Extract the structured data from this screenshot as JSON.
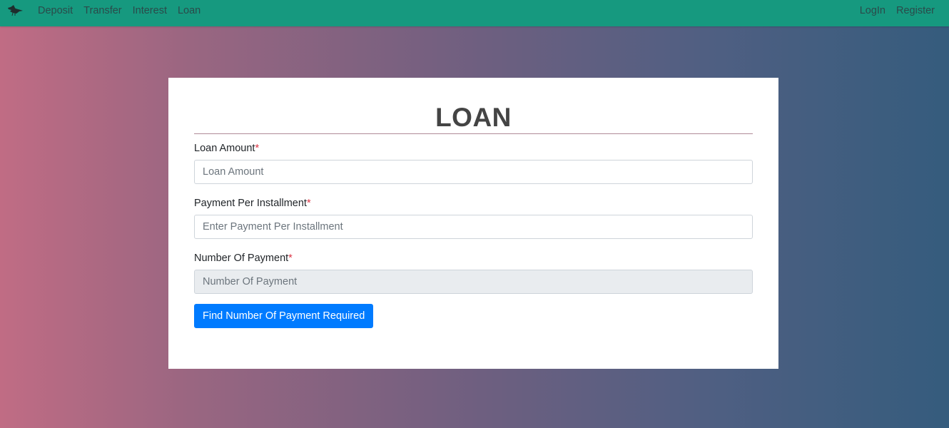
{
  "nav": {
    "brand_icon": "bird-logo-icon",
    "left_links": [
      "Deposit",
      "Transfer",
      "Interest",
      "Loan"
    ],
    "right_links": [
      "LogIn",
      "Register"
    ]
  },
  "form": {
    "title": "LOAN",
    "required_marker": "*",
    "loan_amount": {
      "label": "Loan Amount",
      "placeholder": "Loan Amount",
      "value": ""
    },
    "payment_per_installment": {
      "label": "Payment Per Installment",
      "placeholder": "Enter Payment Per Installment",
      "value": ""
    },
    "number_of_payment": {
      "label": "Number Of Payment",
      "placeholder": "Number Of Payment",
      "value": ""
    },
    "submit_label": "Find Number Of Payment Required"
  },
  "colors": {
    "navbar": "#16997f",
    "button": "#007bff",
    "required": "#dc3545",
    "gradient_start": "#c06c84",
    "gradient_end": "#355c7d"
  }
}
